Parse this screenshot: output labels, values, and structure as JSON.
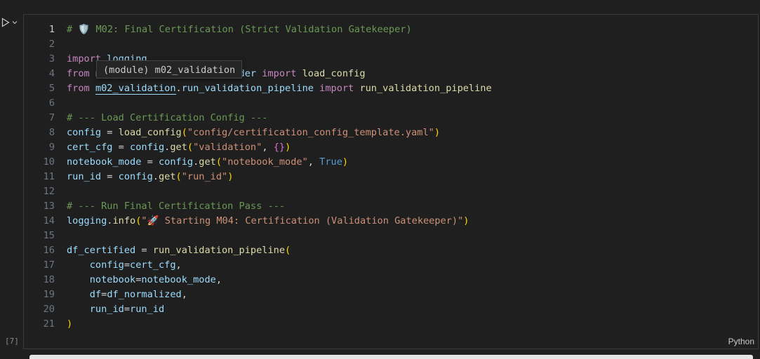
{
  "cell": {
    "execution_count": "[7]",
    "language": "Python",
    "active_line": 1
  },
  "tooltip": {
    "text": "(module) m02_validation"
  },
  "lines": [
    {
      "n": "1",
      "segs": [
        {
          "t": "# ",
          "c": "cm"
        },
        {
          "t": "🛡️",
          "c": "cm"
        },
        {
          "t": " M02: Final Certification (Strict Validation Gatekeeper)",
          "c": "cm"
        }
      ]
    },
    {
      "n": "2",
      "segs": []
    },
    {
      "n": "3",
      "segs": [
        {
          "t": "import",
          "c": "kw"
        },
        {
          "t": " logging",
          "c": "vr"
        }
      ]
    },
    {
      "n": "4",
      "segs": [
        {
          "t": "from",
          "c": "kw"
        },
        {
          "t": " m02_validation.config_loader ",
          "c": "vr"
        },
        {
          "t": "import",
          "c": "kw"
        },
        {
          "t": " ",
          "c": ""
        },
        {
          "t": "load_config",
          "c": "fn"
        }
      ]
    },
    {
      "n": "5",
      "segs": [
        {
          "t": "from",
          "c": "kw"
        },
        {
          "t": " ",
          "c": ""
        },
        {
          "t": "m02_validation",
          "c": "vr hl"
        },
        {
          "t": ".",
          "c": ""
        },
        {
          "t": "run_validation_pipeline",
          "c": "vr"
        },
        {
          "t": " ",
          "c": ""
        },
        {
          "t": "import",
          "c": "kw"
        },
        {
          "t": " ",
          "c": ""
        },
        {
          "t": "run_validation_pipeline",
          "c": "fn"
        }
      ]
    },
    {
      "n": "6",
      "segs": []
    },
    {
      "n": "7",
      "segs": [
        {
          "t": "# --- Load Certification Config ---",
          "c": "cm"
        }
      ]
    },
    {
      "n": "8",
      "segs": [
        {
          "t": "config",
          "c": "vr"
        },
        {
          "t": " = ",
          "c": ""
        },
        {
          "t": "load_config",
          "c": "fn"
        },
        {
          "t": "(",
          "c": "br1"
        },
        {
          "t": "\"config/certification_config_template.yaml\"",
          "c": "st"
        },
        {
          "t": ")",
          "c": "br1"
        }
      ]
    },
    {
      "n": "9",
      "segs": [
        {
          "t": "cert_cfg",
          "c": "vr"
        },
        {
          "t": " = ",
          "c": ""
        },
        {
          "t": "config",
          "c": "vr"
        },
        {
          "t": ".",
          "c": ""
        },
        {
          "t": "get",
          "c": "fn"
        },
        {
          "t": "(",
          "c": "br1"
        },
        {
          "t": "\"validation\"",
          "c": "st"
        },
        {
          "t": ", ",
          "c": ""
        },
        {
          "t": "{}",
          "c": "br2"
        },
        {
          "t": ")",
          "c": "br1"
        }
      ]
    },
    {
      "n": "10",
      "segs": [
        {
          "t": "notebook_mode",
          "c": "vr"
        },
        {
          "t": " = ",
          "c": ""
        },
        {
          "t": "config",
          "c": "vr"
        },
        {
          "t": ".",
          "c": ""
        },
        {
          "t": "get",
          "c": "fn"
        },
        {
          "t": "(",
          "c": "br1"
        },
        {
          "t": "\"notebook_mode\"",
          "c": "st"
        },
        {
          "t": ", ",
          "c": ""
        },
        {
          "t": "True",
          "c": "co"
        },
        {
          "t": ")",
          "c": "br1"
        }
      ]
    },
    {
      "n": "11",
      "segs": [
        {
          "t": "run_id",
          "c": "vr"
        },
        {
          "t": " = ",
          "c": ""
        },
        {
          "t": "config",
          "c": "vr"
        },
        {
          "t": ".",
          "c": ""
        },
        {
          "t": "get",
          "c": "fn"
        },
        {
          "t": "(",
          "c": "br1"
        },
        {
          "t": "\"run_id\"",
          "c": "st"
        },
        {
          "t": ")",
          "c": "br1"
        }
      ]
    },
    {
      "n": "12",
      "segs": []
    },
    {
      "n": "13",
      "segs": [
        {
          "t": "# --- Run Final Certification Pass ---",
          "c": "cm"
        }
      ]
    },
    {
      "n": "14",
      "segs": [
        {
          "t": "logging",
          "c": "vr"
        },
        {
          "t": ".",
          "c": ""
        },
        {
          "t": "info",
          "c": "fn"
        },
        {
          "t": "(",
          "c": "br1"
        },
        {
          "t": "\"🚀 Starting M04: Certification (Validation Gatekeeper)\"",
          "c": "st"
        },
        {
          "t": ")",
          "c": "br1"
        }
      ]
    },
    {
      "n": "15",
      "segs": []
    },
    {
      "n": "16",
      "segs": [
        {
          "t": "df_certified",
          "c": "vr"
        },
        {
          "t": " = ",
          "c": ""
        },
        {
          "t": "run_validation_pipeline",
          "c": "fn"
        },
        {
          "t": "(",
          "c": "br1"
        }
      ]
    },
    {
      "n": "17",
      "segs": [
        {
          "t": "    ",
          "c": ""
        },
        {
          "t": "config",
          "c": "vr"
        },
        {
          "t": "=",
          "c": ""
        },
        {
          "t": "cert_cfg",
          "c": "vr"
        },
        {
          "t": ",",
          "c": ""
        }
      ]
    },
    {
      "n": "18",
      "segs": [
        {
          "t": "    ",
          "c": ""
        },
        {
          "t": "notebook",
          "c": "vr"
        },
        {
          "t": "=",
          "c": ""
        },
        {
          "t": "notebook_mode",
          "c": "vr"
        },
        {
          "t": ",",
          "c": ""
        }
      ]
    },
    {
      "n": "19",
      "segs": [
        {
          "t": "    ",
          "c": ""
        },
        {
          "t": "df",
          "c": "vr"
        },
        {
          "t": "=",
          "c": ""
        },
        {
          "t": "df_normalized",
          "c": "vr"
        },
        {
          "t": ",",
          "c": ""
        }
      ]
    },
    {
      "n": "20",
      "segs": [
        {
          "t": "    ",
          "c": ""
        },
        {
          "t": "run_id",
          "c": "vr"
        },
        {
          "t": "=",
          "c": ""
        },
        {
          "t": "run_id",
          "c": "vr"
        }
      ]
    },
    {
      "n": "21",
      "segs": [
        {
          "t": ")",
          "c": "br1"
        }
      ]
    }
  ]
}
